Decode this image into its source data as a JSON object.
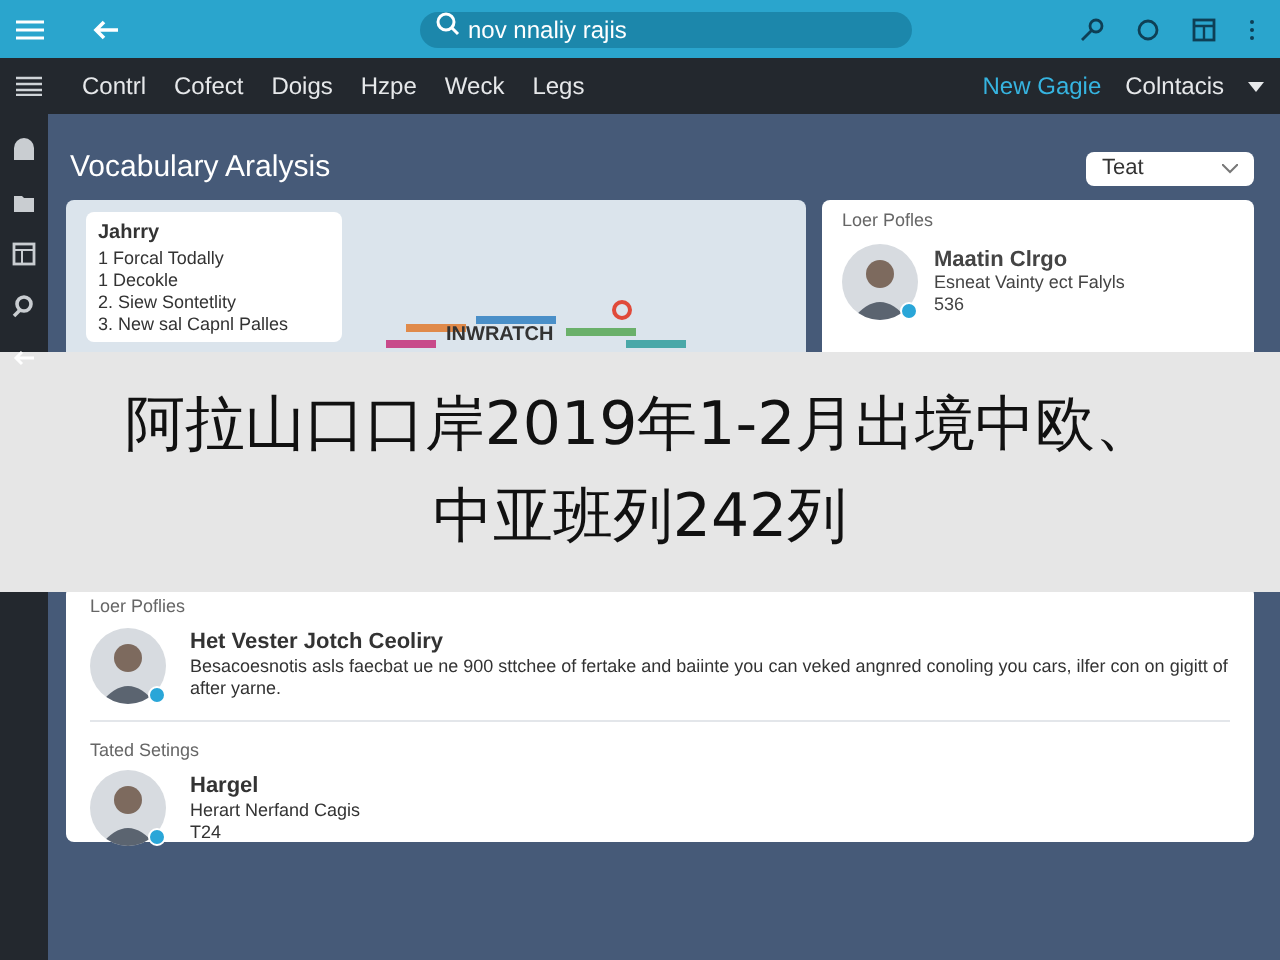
{
  "top_bar": {
    "search": {
      "value": "nov nnaliy rajis"
    }
  },
  "nav": {
    "items": [
      {
        "label": "Contrl",
        "selected": false
      },
      {
        "label": "Cofect",
        "selected": false
      },
      {
        "label": "Doigs",
        "selected": false
      },
      {
        "label": "Hzpe",
        "selected": false
      },
      {
        "label": "Weck",
        "selected": false
      },
      {
        "label": "Legs",
        "selected": false
      }
    ],
    "right": [
      {
        "label": "New Gagie",
        "selected": true
      },
      {
        "label": "Colntacis",
        "selected": false
      }
    ]
  },
  "page": {
    "title": "Vocabulary Aralysis",
    "dropdown": "Teat"
  },
  "summary_card": {
    "title": "Jahrry",
    "items": [
      "1  Forcal Todally",
      "1  Decokle",
      "2.  Siew Sontetlity",
      "3.  New sal Capnl Palles"
    ],
    "cloud_words": [
      "INWRATCH"
    ]
  },
  "profiles_card": {
    "sections": [
      {
        "heading": "Loer Pofles",
        "name": "Maatin Clrgo",
        "subtitle": "Esneat Vainty ect Falyls",
        "count": "536"
      }
    ]
  },
  "bottom_card": {
    "sections": [
      {
        "heading": "Loer Poflies",
        "name": "Het Vester Jotch Ceoliry",
        "text": "Besacoesnotis asls faecbat ue ne 900 sttchee of fertake and baiinte you can veked angnred conoling you cars, ilfer con on gigitt of after yarne."
      },
      {
        "heading": "Tated Setings",
        "name": "Hargel",
        "text": "Herart Nerfand Cagis",
        "count": "T24"
      }
    ]
  },
  "caption": "阿拉山口口岸2019年1-2月出境中欧、中亚班列242列"
}
